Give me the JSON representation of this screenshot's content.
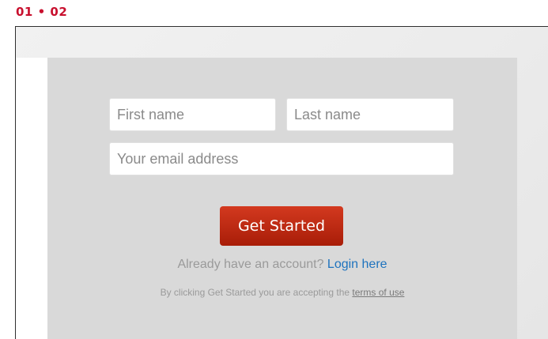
{
  "slide_label": "01 • 02",
  "form": {
    "first_name_placeholder": "First name",
    "last_name_placeholder": "Last name",
    "email_placeholder": "Your email address",
    "submit_label": "Get Started"
  },
  "login": {
    "prompt": "Already have an account?",
    "link_label": "Login here"
  },
  "terms": {
    "prefix": "By clicking Get Started you are accepting the",
    "link_label": "terms of use"
  },
  "colors": {
    "accent_red": "#c8102e",
    "button_red": "#b8260e",
    "link_blue": "#1e73be",
    "panel_gray": "#d9d9d9"
  }
}
